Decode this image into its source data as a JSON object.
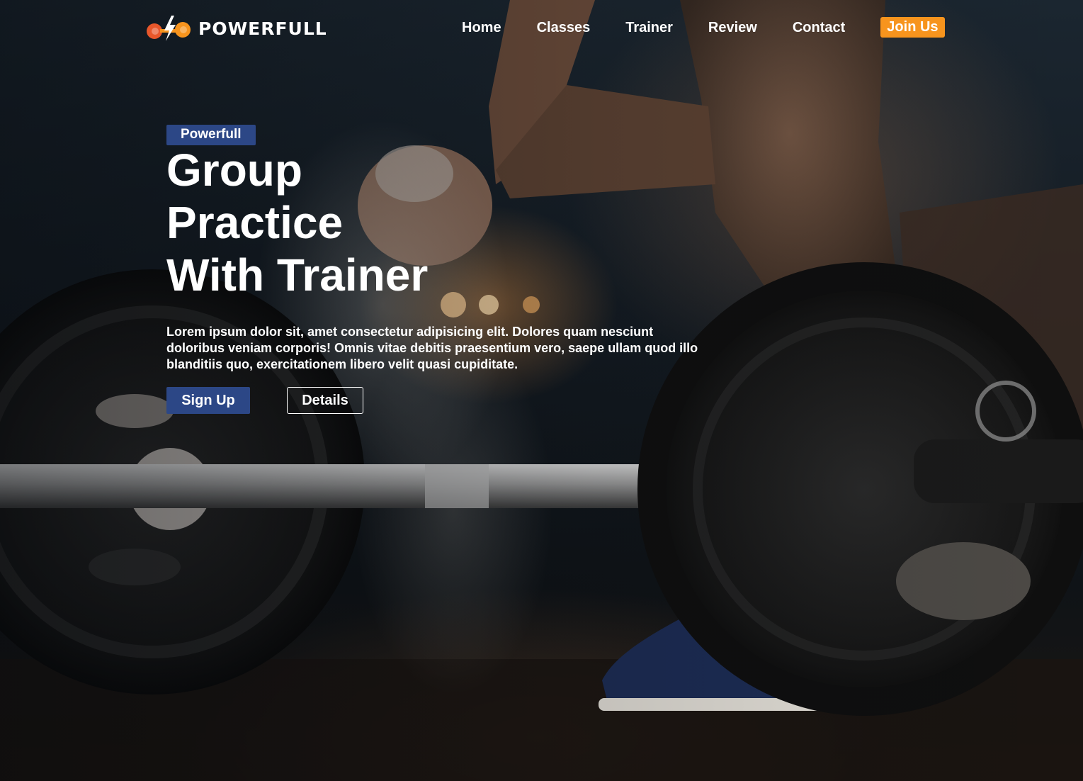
{
  "brand": {
    "name": "POWERFULL",
    "logo_icon": "dumbbell-bolt-icon",
    "logo_colors": [
      "#e8572b",
      "#f7941d",
      "#ffffff"
    ]
  },
  "nav": {
    "items": [
      {
        "label": "Home"
      },
      {
        "label": "Classes"
      },
      {
        "label": "Trainer"
      },
      {
        "label": "Review"
      },
      {
        "label": "Contact"
      }
    ],
    "cta_label": "Join Us"
  },
  "hero": {
    "badge": "Powerfull",
    "headline_lines": [
      "Group",
      "Practice",
      "With Trainer"
    ],
    "description": "Lorem ipsum dolor sit, amet consectetur adipisicing elit. Dolores quam nesciunt doloribus veniam corporis! Omnis vitae debitis praesentium vero, saepe ullam quod illo blanditiis quo, exercitationem libero velit quasi cupiditate.",
    "primary_button": "Sign Up",
    "secondary_button": "Details",
    "background_image": "weightlifter-chalk-barbell-photo"
  },
  "colors": {
    "accent_orange": "#f7941d",
    "primary_blue": "#2c4786",
    "text": "#ffffff"
  }
}
